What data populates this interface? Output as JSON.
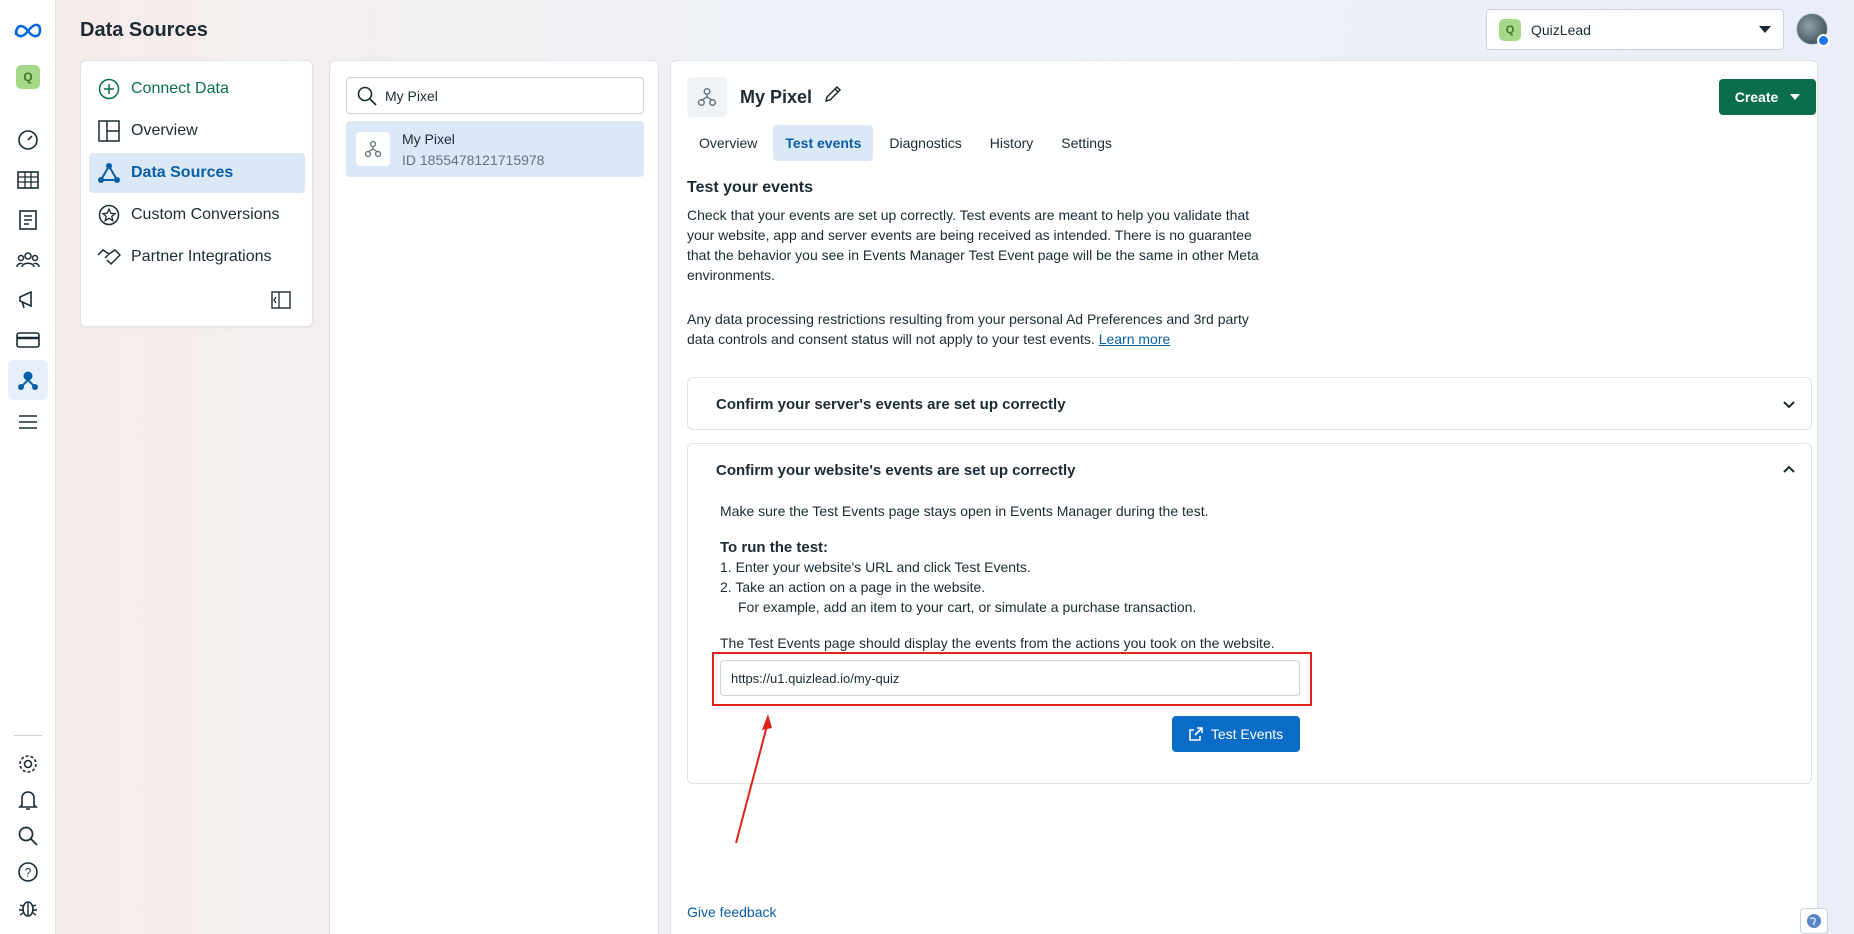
{
  "header": {
    "title": "Data Sources",
    "account_name": "QuizLead",
    "account_initial": "Q"
  },
  "rail": {
    "workspace_initial": "Q"
  },
  "nav": {
    "items": [
      {
        "label": "Connect Data"
      },
      {
        "label": "Overview"
      },
      {
        "label": "Data Sources"
      },
      {
        "label": "Custom Conversions"
      },
      {
        "label": "Partner Integrations"
      }
    ]
  },
  "list": {
    "search_value": "My Pixel",
    "item_name": "My Pixel",
    "item_id": "ID 1855478121715978"
  },
  "main": {
    "pixel_name": "My Pixel",
    "create_label": "Create",
    "tabs": [
      "Overview",
      "Test events",
      "Diagnostics",
      "History",
      "Settings"
    ],
    "section_title": "Test your events",
    "para1": "Check that your events are set up correctly. Test events are meant to help you validate that your website, app and server events are being received as intended. There is no guarantee that the behavior you see in Events Manager Test Event page will be the same in other Meta environments.",
    "para2": "Any data processing restrictions resulting from your personal Ad Preferences and 3rd party data controls and consent status will not apply to your test events.",
    "learn_more": "Learn more",
    "server_accordion": "Confirm your server's events are set up correctly",
    "website_accordion": "Confirm your website's events are set up correctly",
    "keep_open": "Make sure the Test Events page stays open in Events Manager during the test.",
    "run_title": "To run the test:",
    "step1": "1.  Enter your website's URL and click Test Events.",
    "step2": "2.  Take an action on a page in the website.",
    "step2_example": "For example, add an item to your cart, or simulate a purchase transaction.",
    "display_note": "The Test Events page should display the events from the actions you took on the website.",
    "url_value": "https://u1.quizlead.io/my-quiz",
    "test_button": "Test Events",
    "feedback": "Give feedback"
  },
  "colors": {
    "brand_green": "#0a6e4c",
    "accent_blue": "#0a6cc7",
    "highlight_red": "#e0221b"
  }
}
